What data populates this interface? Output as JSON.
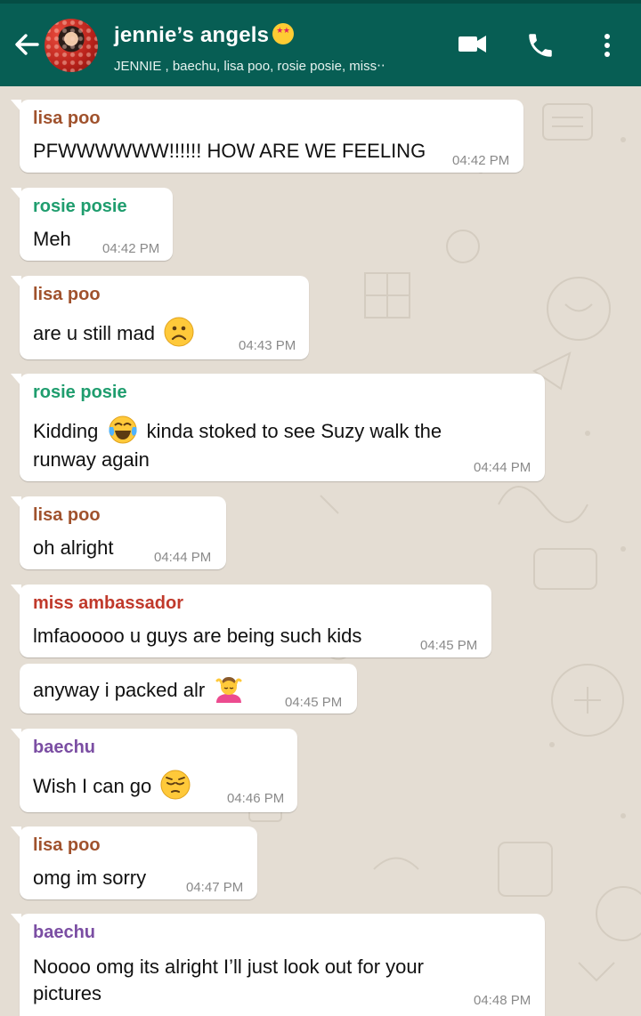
{
  "header": {
    "title": "jennie’s angels",
    "title_emoji": "star-struck-emoji",
    "subtitle": "JENNIE , baechu, lisa poo, rosie posie, miss‧‧",
    "icons": [
      "back-arrow-icon",
      "video-call-icon",
      "phone-icon",
      "more-vert-icon"
    ],
    "color": "#075e54"
  },
  "colors": {
    "lisa": "#a0522d",
    "rosie": "#1f9d6e",
    "miss": "#c0392b",
    "baechu": "#7b4ea3",
    "background": "#e4ddd3"
  },
  "messages": [
    {
      "sender": "lisa poo",
      "text": "PFWWWWWW!!!!!! HOW ARE WE FEELING",
      "time": "04:42 PM"
    },
    {
      "sender": "rosie posie",
      "text": "Meh",
      "time": "04:42 PM"
    },
    {
      "sender": "lisa poo",
      "text": "are u still mad",
      "emoji": "frowning-face-emoji",
      "time": "04:43 PM"
    },
    {
      "sender": "rosie posie",
      "text_a": "Kidding",
      "emoji": "tears-of-joy-emoji",
      "text_b": "kinda stoked to see Suzy walk the",
      "text_c": "runway again",
      "time": "04:44 PM"
    },
    {
      "sender": "lisa poo",
      "text": "oh alright",
      "time": "04:44 PM"
    },
    {
      "sender": "miss ambassador",
      "text": "lmfaooooo u guys are being such kids",
      "time": "04:45 PM"
    },
    {
      "sender": "",
      "text": "anyway i packed alr",
      "emoji": "person-getting-massage-emoji",
      "time": "04:45 PM"
    },
    {
      "sender": "baechu",
      "text": "Wish I can go",
      "emoji": "pensive-face-emoji",
      "time": "04:46 PM"
    },
    {
      "sender": "lisa poo",
      "text": "omg im sorry",
      "time": "04:47 PM"
    },
    {
      "sender": "baechu",
      "text": "Noooo omg its alright I’ll just look out for your",
      "text_c": "pictures",
      "time": "04:48 PM"
    }
  ]
}
